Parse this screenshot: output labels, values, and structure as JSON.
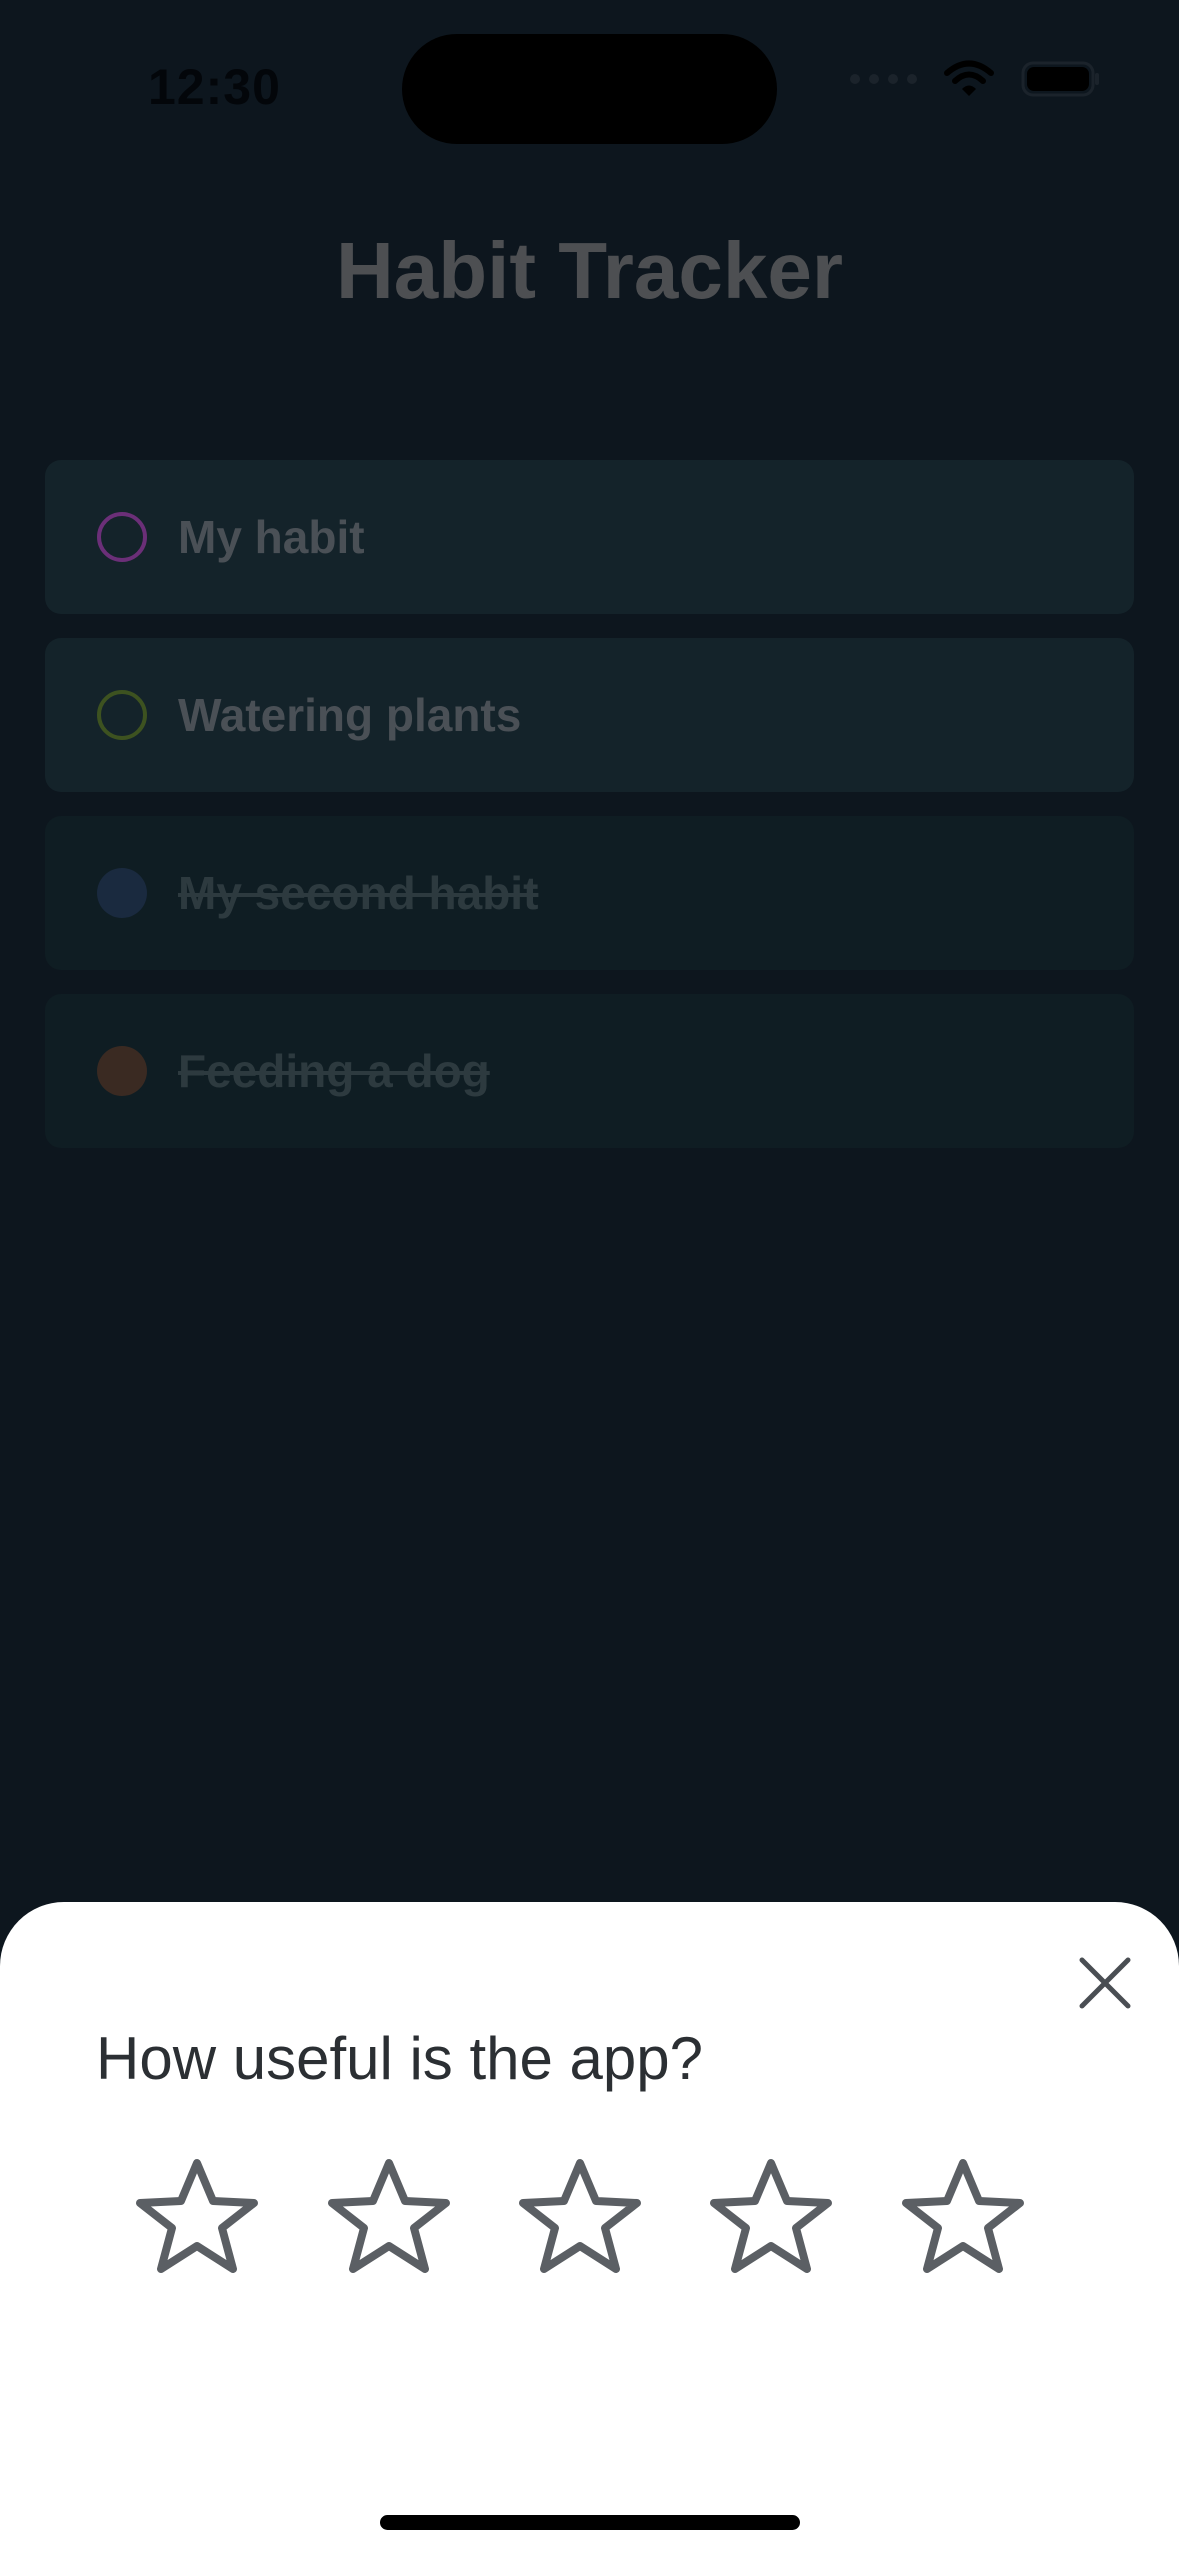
{
  "status_bar": {
    "time": "12:30",
    "icons": [
      "cellular-signal-icon",
      "wifi-icon",
      "battery-icon"
    ]
  },
  "header": {
    "title": "Habit Tracker"
  },
  "habits": [
    {
      "label": "My habit",
      "completed": false,
      "color": "#6b2f78"
    },
    {
      "label": "Watering plants",
      "completed": false,
      "color": "#3d5220"
    },
    {
      "label": "My second habit",
      "completed": true,
      "color": "#1a2a3f"
    },
    {
      "label": "Feeding a dog",
      "completed": true,
      "color": "#3a2a22"
    }
  ],
  "rating_sheet": {
    "title": "How useful is the app?",
    "close_icon": "close-icon",
    "stars": [
      {
        "icon": "star-outline-icon"
      },
      {
        "icon": "star-outline-icon"
      },
      {
        "icon": "star-outline-icon"
      },
      {
        "icon": "star-outline-icon"
      },
      {
        "icon": "star-outline-icon"
      }
    ],
    "rating": 0,
    "max_rating": 5
  },
  "colors": {
    "background": "#0d161e",
    "sheet_background": "#ffffff",
    "star_stroke": "#5b5f64",
    "title_dimmed": "#4d4f52"
  }
}
